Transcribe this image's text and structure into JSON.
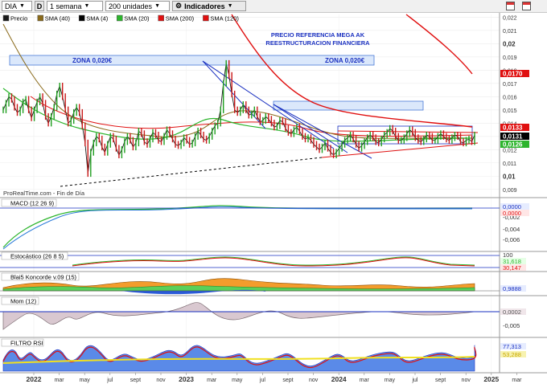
{
  "toolbar": {
    "symbol": "DIA",
    "mode": "D",
    "period": "1 semana",
    "units": "200 unidades",
    "indicators": "Indicadores"
  },
  "price_panel": {
    "legend": [
      "Precio",
      "SMA (40)",
      "SMA (4)",
      "SMA (20)",
      "SMA (200)",
      "SMA (120)"
    ],
    "legend_colors": [
      "#1a1a1a",
      "#8a6a1a",
      "#000000",
      "#2db52d",
      "#e01010",
      "#e01010"
    ],
    "annotation": [
      "PRECIO REFERENCIA MEGA AK",
      "REESTRUCTURACION FINANCIERA"
    ],
    "zone_label_left": "ZONA 0,020€",
    "zone_label_right": "ZONA 0,020€",
    "watermark": "ProRealTime.com - Fin de Día",
    "yticks": [
      "0,022",
      "0,021",
      "0,02",
      "0,019",
      "0,018",
      "0,017",
      "0,016",
      "0,015",
      "0,014",
      "0,013",
      "0,012",
      "0,011",
      "0,01",
      "0,009"
    ],
    "tags": [
      {
        "text": "0,0170",
        "color": "#e01010",
        "value": 0.01703
      },
      {
        "text": "0,0133",
        "color": "#e01010",
        "value": 0.01335
      },
      {
        "text": "0,0131",
        "color": "#000000",
        "value": 0.01313
      },
      {
        "text": "0,0126",
        "color": "#2db52d",
        "value": 0.01262
      }
    ]
  },
  "macd_panel": {
    "label": "MACD (12 26 9)",
    "yticks": [
      "-0,002",
      "-0,004",
      "-0,006"
    ],
    "tags": [
      "0,0000",
      "0,0000"
    ]
  },
  "stoch_panel": {
    "label": "Estocástico (26 8 5)",
    "yticks": [
      "100",
      "0"
    ],
    "tags": [
      "31,618",
      "30,147"
    ]
  },
  "koncorde_panel": {
    "label": "Blai5 Koncorde v.09 (15)",
    "tags": [
      "0,9888"
    ]
  },
  "mom_panel": {
    "label": "Mom (12)",
    "yticks": [
      "-0,005"
    ],
    "tags": [
      "0,0002"
    ]
  },
  "rsi_panel": {
    "label": "FILTRO RSI",
    "tags": [
      "77,313",
      "53,288"
    ]
  },
  "x_axis": {
    "labels": [
      "2022",
      "mar",
      "may",
      "jul",
      "sept",
      "nov",
      "2023",
      "mar",
      "may",
      "jul",
      "sept",
      "nov",
      "2024",
      "mar",
      "may",
      "jul",
      "sept",
      "nov",
      "2025",
      "mar"
    ]
  },
  "chart_data": {
    "type": "line",
    "price_axis": {
      "ylim": [
        0.0085,
        0.0222
      ],
      "log": false
    },
    "x_range": [
      "2021-10",
      "2025-04"
    ],
    "close": [
      0.015,
      0.0155,
      0.016,
      0.0158,
      0.0152,
      0.0148,
      0.015,
      0.0156,
      0.0158,
      0.015,
      0.0144,
      0.015,
      0.0156,
      0.016,
      0.0155,
      0.0145,
      0.014,
      0.0145,
      0.0152,
      0.0162,
      0.0168,
      0.016,
      0.015,
      0.014,
      0.0142,
      0.0148,
      0.0152,
      0.0148,
      0.0138,
      0.0125,
      0.0102,
      0.0118,
      0.0125,
      0.013,
      0.0128,
      0.0122,
      0.0118,
      0.0124,
      0.013,
      0.0128,
      0.0121,
      0.0116,
      0.012,
      0.0126,
      0.013,
      0.0127,
      0.0122,
      0.0125,
      0.0134,
      0.0132,
      0.0126,
      0.0124,
      0.0128,
      0.0133,
      0.0131,
      0.0127,
      0.0126,
      0.013,
      0.0135,
      0.0132,
      0.0128,
      0.0124,
      0.0123,
      0.0125,
      0.0129,
      0.0127,
      0.0124,
      0.0125,
      0.013,
      0.0134,
      0.0131,
      0.0128,
      0.0127,
      0.013,
      0.0134,
      0.0138,
      0.014,
      0.015,
      0.017,
      0.0185,
      0.0176,
      0.0162,
      0.015,
      0.0148,
      0.015,
      0.0154,
      0.015,
      0.0146,
      0.0147,
      0.015,
      0.0145,
      0.0141,
      0.0142,
      0.0145,
      0.0143,
      0.014,
      0.0137,
      0.0138,
      0.0142,
      0.0141,
      0.0136,
      0.0133,
      0.0132,
      0.0135,
      0.0137,
      0.0134,
      0.013,
      0.0128,
      0.0129,
      0.0127,
      0.0124,
      0.0122,
      0.012,
      0.0122,
      0.0125,
      0.0121,
      0.0118,
      0.0116,
      0.0118,
      0.0121,
      0.0124,
      0.0127,
      0.0129,
      0.0131,
      0.0128,
      0.0124,
      0.0121,
      0.0123,
      0.0126,
      0.0129,
      0.0131,
      0.0129,
      0.0126,
      0.0125,
      0.0128,
      0.0131,
      0.0133,
      0.0136,
      0.0134,
      0.013,
      0.0127,
      0.0127,
      0.0129,
      0.0132,
      0.0135,
      0.0133,
      0.0129,
      0.0127,
      0.0126,
      0.0128,
      0.0131,
      0.013,
      0.0127,
      0.0127,
      0.013,
      0.0132,
      0.013,
      0.0128,
      0.0127,
      0.0129,
      0.0131,
      0.013,
      0.0126,
      0.0125,
      0.0127,
      0.0128,
      0.0126,
      0.0131
    ]
  }
}
